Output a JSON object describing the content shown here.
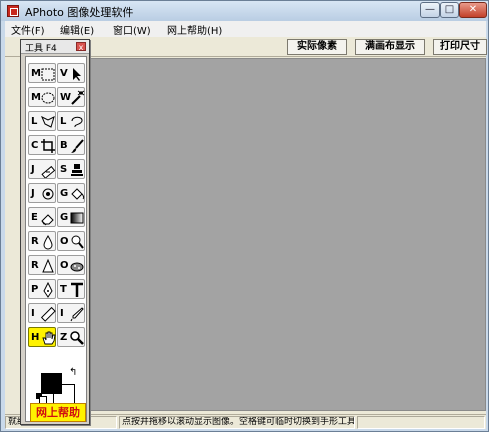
{
  "window": {
    "title": "APhoto 图像处理软件",
    "min_glyph": "—",
    "max_glyph": "□",
    "close_glyph": "✕"
  },
  "menu": [
    {
      "label": "文件(F)"
    },
    {
      "label": "编辑(E)"
    },
    {
      "label": "窗口(W)"
    },
    {
      "label": "网上帮助(H)"
    }
  ],
  "toolbar": {
    "actual_pixels": "实际像素",
    "fill_canvas": "满画布显示",
    "print_size": "打印尺寸"
  },
  "palette": {
    "title": "工具 F4",
    "close_glyph": "x",
    "tools": [
      {
        "key": "M",
        "icon": "rect-marquee-icon"
      },
      {
        "key": "V",
        "icon": "move-icon"
      },
      {
        "key": "M",
        "icon": "ellipse-marquee-icon"
      },
      {
        "key": "W",
        "icon": "magic-wand-icon"
      },
      {
        "key": "L",
        "icon": "polygon-lasso-icon"
      },
      {
        "key": "L",
        "icon": "lasso-icon"
      },
      {
        "key": "C",
        "icon": "crop-icon"
      },
      {
        "key": "B",
        "icon": "brush-icon"
      },
      {
        "key": "J",
        "icon": "healing-brush-icon"
      },
      {
        "key": "S",
        "icon": "clone-stamp-icon"
      },
      {
        "key": "J",
        "icon": "spot-healing-icon"
      },
      {
        "key": "G",
        "icon": "paint-bucket-icon"
      },
      {
        "key": "E",
        "icon": "eraser-icon"
      },
      {
        "key": "G",
        "icon": "gradient-icon"
      },
      {
        "key": "R",
        "icon": "blur-icon"
      },
      {
        "key": "O",
        "icon": "dodge-icon"
      },
      {
        "key": "R",
        "icon": "sharpen-icon"
      },
      {
        "key": "O",
        "icon": "sponge-icon"
      },
      {
        "key": "P",
        "icon": "pen-icon"
      },
      {
        "key": "T",
        "icon": "text-icon"
      },
      {
        "key": "I",
        "icon": "ruler-icon"
      },
      {
        "key": "I",
        "icon": "eyedropper-icon"
      },
      {
        "key": "H",
        "icon": "hand-icon",
        "active": true
      },
      {
        "key": "Z",
        "icon": "zoom-icon"
      }
    ],
    "foreground_color": "#000000",
    "background_color": "#ffffff",
    "help_label": "网上帮助"
  },
  "status": {
    "left": "就绪",
    "middle": "点按并拖移以滚动显示图像。空格键可临时切换到手形工具。",
    "right": ""
  },
  "colors": {
    "canvas_bg": "#a3a3a3",
    "active_tool": "#fff200",
    "help_text": "#d01010"
  }
}
